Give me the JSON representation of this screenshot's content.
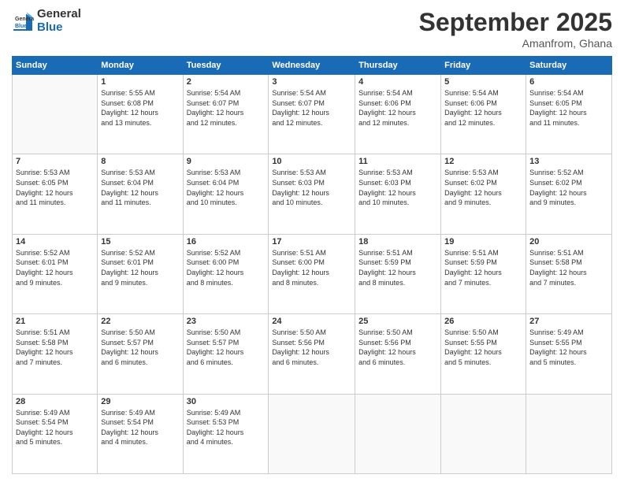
{
  "header": {
    "logo_line1": "General",
    "logo_line2": "Blue",
    "month": "September 2025",
    "location": "Amanfrom, Ghana"
  },
  "days_of_week": [
    "Sunday",
    "Monday",
    "Tuesday",
    "Wednesday",
    "Thursday",
    "Friday",
    "Saturday"
  ],
  "weeks": [
    [
      {
        "day": "",
        "info": ""
      },
      {
        "day": "1",
        "info": "Sunrise: 5:55 AM\nSunset: 6:08 PM\nDaylight: 12 hours\nand 13 minutes."
      },
      {
        "day": "2",
        "info": "Sunrise: 5:54 AM\nSunset: 6:07 PM\nDaylight: 12 hours\nand 12 minutes."
      },
      {
        "day": "3",
        "info": "Sunrise: 5:54 AM\nSunset: 6:07 PM\nDaylight: 12 hours\nand 12 minutes."
      },
      {
        "day": "4",
        "info": "Sunrise: 5:54 AM\nSunset: 6:06 PM\nDaylight: 12 hours\nand 12 minutes."
      },
      {
        "day": "5",
        "info": "Sunrise: 5:54 AM\nSunset: 6:06 PM\nDaylight: 12 hours\nand 12 minutes."
      },
      {
        "day": "6",
        "info": "Sunrise: 5:54 AM\nSunset: 6:05 PM\nDaylight: 12 hours\nand 11 minutes."
      }
    ],
    [
      {
        "day": "7",
        "info": "Sunrise: 5:53 AM\nSunset: 6:05 PM\nDaylight: 12 hours\nand 11 minutes."
      },
      {
        "day": "8",
        "info": "Sunrise: 5:53 AM\nSunset: 6:04 PM\nDaylight: 12 hours\nand 11 minutes."
      },
      {
        "day": "9",
        "info": "Sunrise: 5:53 AM\nSunset: 6:04 PM\nDaylight: 12 hours\nand 10 minutes."
      },
      {
        "day": "10",
        "info": "Sunrise: 5:53 AM\nSunset: 6:03 PM\nDaylight: 12 hours\nand 10 minutes."
      },
      {
        "day": "11",
        "info": "Sunrise: 5:53 AM\nSunset: 6:03 PM\nDaylight: 12 hours\nand 10 minutes."
      },
      {
        "day": "12",
        "info": "Sunrise: 5:53 AM\nSunset: 6:02 PM\nDaylight: 12 hours\nand 9 minutes."
      },
      {
        "day": "13",
        "info": "Sunrise: 5:52 AM\nSunset: 6:02 PM\nDaylight: 12 hours\nand 9 minutes."
      }
    ],
    [
      {
        "day": "14",
        "info": "Sunrise: 5:52 AM\nSunset: 6:01 PM\nDaylight: 12 hours\nand 9 minutes."
      },
      {
        "day": "15",
        "info": "Sunrise: 5:52 AM\nSunset: 6:01 PM\nDaylight: 12 hours\nand 9 minutes."
      },
      {
        "day": "16",
        "info": "Sunrise: 5:52 AM\nSunset: 6:00 PM\nDaylight: 12 hours\nand 8 minutes."
      },
      {
        "day": "17",
        "info": "Sunrise: 5:51 AM\nSunset: 6:00 PM\nDaylight: 12 hours\nand 8 minutes."
      },
      {
        "day": "18",
        "info": "Sunrise: 5:51 AM\nSunset: 5:59 PM\nDaylight: 12 hours\nand 8 minutes."
      },
      {
        "day": "19",
        "info": "Sunrise: 5:51 AM\nSunset: 5:59 PM\nDaylight: 12 hours\nand 7 minutes."
      },
      {
        "day": "20",
        "info": "Sunrise: 5:51 AM\nSunset: 5:58 PM\nDaylight: 12 hours\nand 7 minutes."
      }
    ],
    [
      {
        "day": "21",
        "info": "Sunrise: 5:51 AM\nSunset: 5:58 PM\nDaylight: 12 hours\nand 7 minutes."
      },
      {
        "day": "22",
        "info": "Sunrise: 5:50 AM\nSunset: 5:57 PM\nDaylight: 12 hours\nand 6 minutes."
      },
      {
        "day": "23",
        "info": "Sunrise: 5:50 AM\nSunset: 5:57 PM\nDaylight: 12 hours\nand 6 minutes."
      },
      {
        "day": "24",
        "info": "Sunrise: 5:50 AM\nSunset: 5:56 PM\nDaylight: 12 hours\nand 6 minutes."
      },
      {
        "day": "25",
        "info": "Sunrise: 5:50 AM\nSunset: 5:56 PM\nDaylight: 12 hours\nand 6 minutes."
      },
      {
        "day": "26",
        "info": "Sunrise: 5:50 AM\nSunset: 5:55 PM\nDaylight: 12 hours\nand 5 minutes."
      },
      {
        "day": "27",
        "info": "Sunrise: 5:49 AM\nSunset: 5:55 PM\nDaylight: 12 hours\nand 5 minutes."
      }
    ],
    [
      {
        "day": "28",
        "info": "Sunrise: 5:49 AM\nSunset: 5:54 PM\nDaylight: 12 hours\nand 5 minutes."
      },
      {
        "day": "29",
        "info": "Sunrise: 5:49 AM\nSunset: 5:54 PM\nDaylight: 12 hours\nand 4 minutes."
      },
      {
        "day": "30",
        "info": "Sunrise: 5:49 AM\nSunset: 5:53 PM\nDaylight: 12 hours\nand 4 minutes."
      },
      {
        "day": "",
        "info": ""
      },
      {
        "day": "",
        "info": ""
      },
      {
        "day": "",
        "info": ""
      },
      {
        "day": "",
        "info": ""
      }
    ]
  ]
}
